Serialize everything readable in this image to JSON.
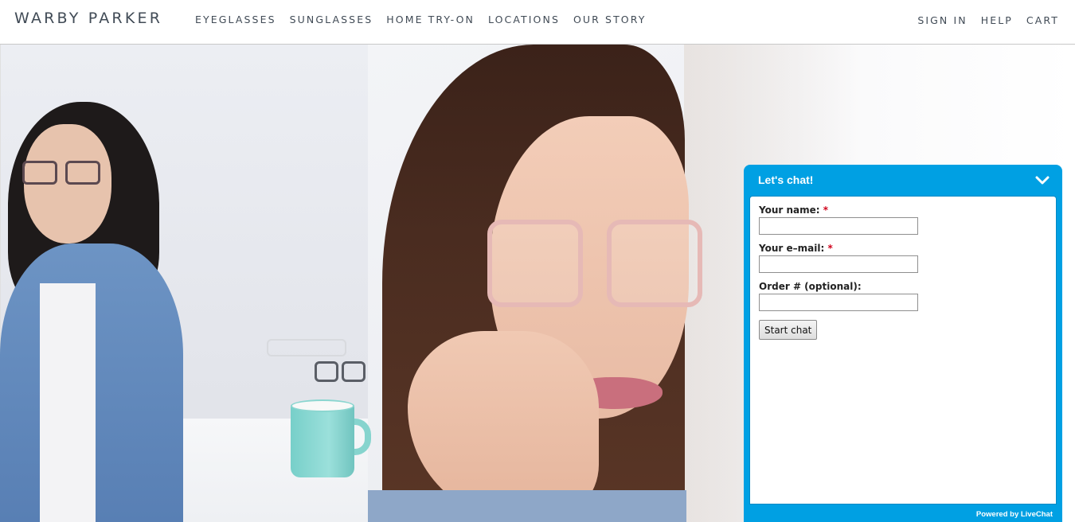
{
  "header": {
    "logo": "WARBY PARKER",
    "nav_main": [
      "EYEGLASSES",
      "SUNGLASSES",
      "HOME TRY-ON",
      "LOCATIONS",
      "OUR STORY"
    ],
    "nav_util": [
      "SIGN IN",
      "HELP",
      "CART"
    ]
  },
  "chat": {
    "title": "Let's chat!",
    "toggle_icon": "chevron-down-icon",
    "fields": [
      {
        "label": "Your name:",
        "required": "*",
        "value": ""
      },
      {
        "label": "Your e–mail:",
        "required": "*",
        "value": ""
      },
      {
        "label": "Order # (optional):",
        "required": "",
        "value": ""
      }
    ],
    "start_button": "Start chat",
    "powered_by": "Powered by LiveChat"
  },
  "colors": {
    "chat_accent": "#00a0e3",
    "nav_text": "#414b56",
    "required": "#d0021b"
  }
}
